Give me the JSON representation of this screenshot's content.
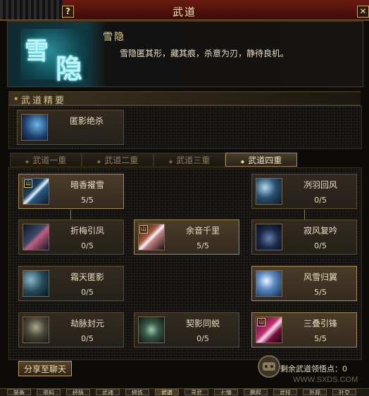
{
  "window": {
    "title": "武道",
    "help_label": "?",
    "close_label": "✕"
  },
  "header": {
    "logo_chars": [
      "雪",
      "隐"
    ],
    "skill_name": "雪隐",
    "skill_desc": "雪隐匿其形，藏其痕，杀意为刃，静待良机。"
  },
  "essence": {
    "title": "武道精要",
    "skill": {
      "name": "匿影绝杀",
      "icon": "shadow-assassin-icon"
    }
  },
  "tabs": [
    {
      "label": "武道一重",
      "selected": false
    },
    {
      "label": "武道二重",
      "selected": false
    },
    {
      "label": "武道三重",
      "selected": false
    },
    {
      "label": "武道四重",
      "selected": true
    }
  ],
  "skills": [
    {
      "name": "暗香擢雪",
      "level": "5/5",
      "active": true,
      "icon": "blade-icon"
    },
    {
      "name": "冽羽回风",
      "level": "0/5",
      "active": false,
      "icon": "wind-icon"
    },
    {
      "name": "折梅引凤",
      "level": "0/5",
      "active": false,
      "icon": "plum-blade-icon"
    },
    {
      "name": "余音千里",
      "level": "5/5",
      "active": true,
      "icon": "echo-blade-icon"
    },
    {
      "name": "寂风复吟",
      "level": "0/5",
      "active": false,
      "icon": "silent-wind-icon"
    },
    {
      "name": "霜天匿影",
      "level": "0/5",
      "active": false,
      "icon": "frost-icon"
    },
    {
      "name": "风雪归翼",
      "level": "5/5",
      "active": true,
      "icon": "snow-wing-icon"
    },
    {
      "name": "劫脉封元",
      "level": "0/5",
      "active": false,
      "icon": "ghost-face-icon"
    },
    {
      "name": "契影同蜕",
      "level": "0/5",
      "active": false,
      "icon": "vortex-icon"
    },
    {
      "name": "三叠引锋",
      "level": "5/5",
      "active": true,
      "icon": "triple-blade-icon"
    }
  ],
  "footer": {
    "share_label": "分享至聊天",
    "remaining_label": "剩余武道领悟点：",
    "remaining_value": "0"
  },
  "watermark": {
    "text": "WWW.SXDS.COM"
  },
  "bottom_tabs": [
    "装备",
    "资料",
    "经脉",
    "武魂",
    "修炼",
    "武道",
    "寻武",
    "七情",
    "鹏程",
    "武技",
    "外观",
    "社交"
  ],
  "colors": {
    "accent": "#c8a455",
    "title_bg": "#5a160c",
    "text": "#e8dcc0"
  }
}
